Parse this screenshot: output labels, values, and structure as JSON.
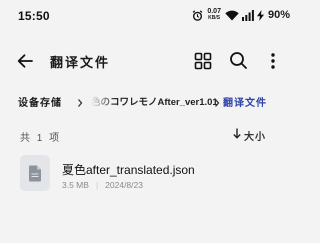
{
  "status_bar": {
    "time": "15:50",
    "net_speed_value": "0.07",
    "net_speed_unit": "KB/S",
    "battery": "90%",
    "icons": [
      "alarm-icon",
      "wifi-icon",
      "signal-icon",
      "charging-bolt-icon",
      "battery-icon"
    ]
  },
  "toolbar": {
    "title": "翻译文件",
    "icons": [
      "back-arrow-icon",
      "grid-view-icon",
      "search-icon",
      "more-vertical-icon"
    ]
  },
  "breadcrumb": {
    "items": [
      "设备存储",
      "色のコワレモノAfter_ver1.01",
      "翻译文件"
    ],
    "accent_color": "#2f44a8"
  },
  "list": {
    "count_label": "共 1 项",
    "sort_label": "大小",
    "files": [
      {
        "name": "夏色after_translated.json",
        "size": "3.5 MB",
        "date": "2024/8/23"
      }
    ]
  }
}
